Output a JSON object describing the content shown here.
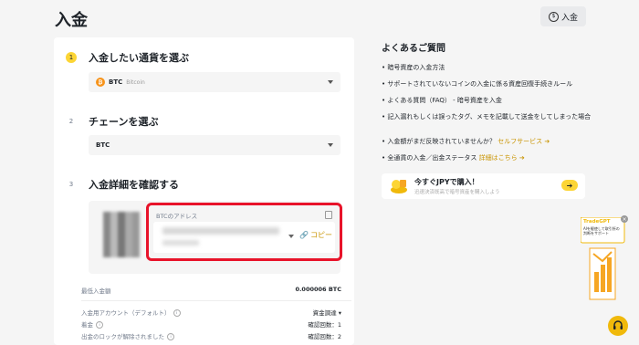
{
  "page": {
    "title": "入金"
  },
  "header": {
    "deposit_button_label": "入金",
    "deposit_button_icon": "coin-icon"
  },
  "steps": [
    {
      "number": "1",
      "title": "入金したい通貨を選ぶ"
    },
    {
      "number": "2",
      "title": "チェーンを選ぶ"
    },
    {
      "number": "3",
      "title": "入金詳細を確認する"
    }
  ],
  "coin_select": {
    "symbol": "BTC",
    "name": "Bitcoin",
    "icon_glyph": "₿"
  },
  "chain_select": {
    "value": "BTC"
  },
  "address": {
    "label": "BTCのアドレス",
    "copy_label": "コピー"
  },
  "details": {
    "min_deposit_label": "最低入金額",
    "min_deposit_value": "0.000006 BTC",
    "account_label": "入金用アカウント（デフォルト）",
    "account_value": "資金調達",
    "credit_label": "着金",
    "credit_value": "確認回数：1",
    "unlock_label": "出金のロックが解除されました",
    "unlock_value": "確認回数：2"
  },
  "faq": {
    "title": "よくあるご質問",
    "items": [
      "暗号資産の入金方法",
      "サポートされていないコインの入金に係る資産回復手続きルール",
      "よくある質問（FAQ） - 暗号資産を入金",
      "記入漏れもしくは誤ったタグ、メモを記載して送金をしてしまった場合"
    ],
    "not_reflected_text": "入金額がまだ反映されていませんか？",
    "not_reflected_link": "セルフサービス ➔",
    "status_text": "全通貨の入金／出金ステータス",
    "status_link": "詳細はこちら ➔"
  },
  "promo": {
    "title": "今すぐJPYで購入！",
    "subtitle": "迅速決済既高で暗号資産を購入しよう",
    "arrow": "➔"
  },
  "ad": {
    "title": "TradeGPT",
    "text": "AIを駆使して取引所の判断をサポート"
  },
  "colors": {
    "accent": "#fcd535",
    "highlight_border": "#e8132a",
    "link": "#c99400"
  }
}
